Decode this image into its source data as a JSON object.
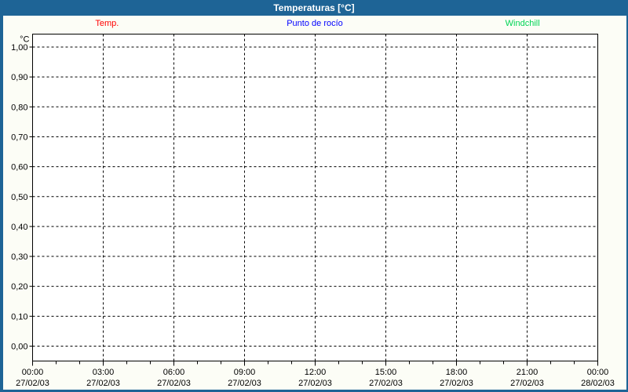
{
  "window": {
    "title": "Temperaturas [°C]"
  },
  "colors": {
    "frame": "#1e6496",
    "title_text": "#ffffff",
    "content_bg": "#fcfdf6",
    "plot_bg": "#ffffff",
    "axis": "#000000",
    "grid": "#000000",
    "text": "#000000"
  },
  "legend": {
    "items": [
      {
        "label": "Temp.",
        "color": "#ff0000"
      },
      {
        "label": "Punto de rocío",
        "color": "#0000ff"
      },
      {
        "label": "Windchill",
        "color": "#00d455"
      }
    ]
  },
  "chart_data": {
    "type": "line",
    "title": "Temperaturas [°C]",
    "ylabel": "°C",
    "xlabel": "",
    "ylim": [
      0.0,
      1.0
    ],
    "ytick_step": 0.1,
    "grid": true,
    "legend_position": "top",
    "yticks": [
      {
        "value": 1.0,
        "label": "1,00"
      },
      {
        "value": 0.9,
        "label": "0,90"
      },
      {
        "value": 0.8,
        "label": "0,80"
      },
      {
        "value": 0.7,
        "label": "0,70"
      },
      {
        "value": 0.6,
        "label": "0,60"
      },
      {
        "value": 0.5,
        "label": "0,50"
      },
      {
        "value": 0.4,
        "label": "0,40"
      },
      {
        "value": 0.3,
        "label": "0,30"
      },
      {
        "value": 0.2,
        "label": "0,20"
      },
      {
        "value": 0.1,
        "label": "0,10"
      },
      {
        "value": 0.0,
        "label": "0,00"
      }
    ],
    "x_axis": {
      "minor_subdivisions": 3,
      "major_ticks": [
        {
          "time": "00:00",
          "date": "27/02/03"
        },
        {
          "time": "03:00",
          "date": "27/02/03"
        },
        {
          "time": "06:00",
          "date": "27/02/03"
        },
        {
          "time": "09:00",
          "date": "27/02/03"
        },
        {
          "time": "12:00",
          "date": "27/02/03"
        },
        {
          "time": "15:00",
          "date": "27/02/03"
        },
        {
          "time": "18:00",
          "date": "27/02/03"
        },
        {
          "time": "21:00",
          "date": "27/02/03"
        },
        {
          "time": "00:00",
          "date": "28/02/03"
        }
      ]
    },
    "series": [
      {
        "name": "Temp.",
        "color": "#ff0000",
        "values": []
      },
      {
        "name": "Punto de rocío",
        "color": "#0000ff",
        "values": []
      },
      {
        "name": "Windchill",
        "color": "#00d455",
        "values": []
      }
    ]
  }
}
